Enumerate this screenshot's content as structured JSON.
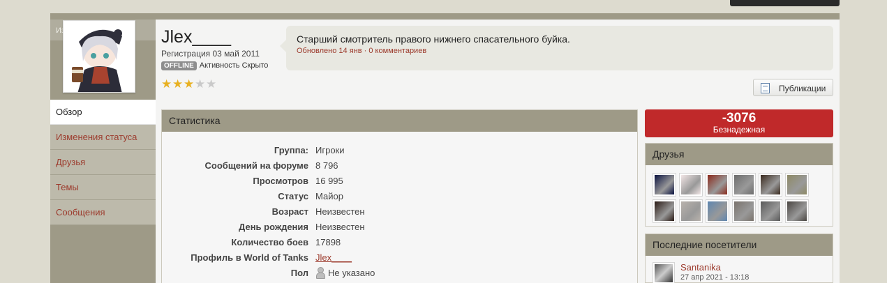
{
  "sidebar": {
    "edit_label": "Изменить",
    "nav": [
      {
        "label": "Обзор",
        "active": true
      },
      {
        "label": "Изменения статуса",
        "active": false
      },
      {
        "label": "Друзья",
        "active": false
      },
      {
        "label": "Темы",
        "active": false
      },
      {
        "label": "Сообщения",
        "active": false
      }
    ]
  },
  "profile": {
    "username": "Jlex____",
    "registration": "Регистрация 03 май 2011",
    "presence_badge": "OFFLINE",
    "activity": "Активность Скрыто",
    "rating": {
      "value": 3,
      "max": 5
    }
  },
  "status": {
    "text": "Старший смотритель правого нижнего спасательного буйка.",
    "meta": "Обновлено 14 янв · 0 комментариев"
  },
  "publications_button": "Публикации",
  "stats": {
    "title": "Статистика",
    "rows": [
      {
        "key": "Группа:",
        "value": "Игроки"
      },
      {
        "key": "Сообщений на форуме",
        "value": "8 796"
      },
      {
        "key": "Просмотров",
        "value": "16 995"
      },
      {
        "key": "Статус",
        "value": "Майор"
      },
      {
        "key": "Возраст",
        "value": "Неизвестен"
      },
      {
        "key": "День рождения",
        "value": "Неизвестен"
      },
      {
        "key": "Количество боев",
        "value": "17898"
      },
      {
        "key": "Профиль в World of Tanks",
        "value": "Jlex____",
        "link": true
      },
      {
        "key": "Пол",
        "value": "Не указано",
        "icon": "person-icon"
      }
    ]
  },
  "reputation": {
    "value": "-3076",
    "label": "Безнадежная"
  },
  "friends": {
    "title": "Друзья",
    "avatars": [
      "#0a1240",
      "#f2e6e6",
      "#8b2a1c",
      "#6d6d6d",
      "#3a2a1e",
      "#8e8a66",
      "#2a1a14",
      "#b8b2ac",
      "#5e86b0",
      "#7a736c",
      "#5a5a5a",
      "#4a4642"
    ]
  },
  "visitors": {
    "title": "Последние посетители",
    "items": [
      {
        "name": "Santanika",
        "date": "27 апр 2021 - 13:18"
      }
    ]
  },
  "colors": {
    "accent": "#9c3a2c",
    "header": "#9e9a87",
    "reputation": "#c0292a"
  }
}
